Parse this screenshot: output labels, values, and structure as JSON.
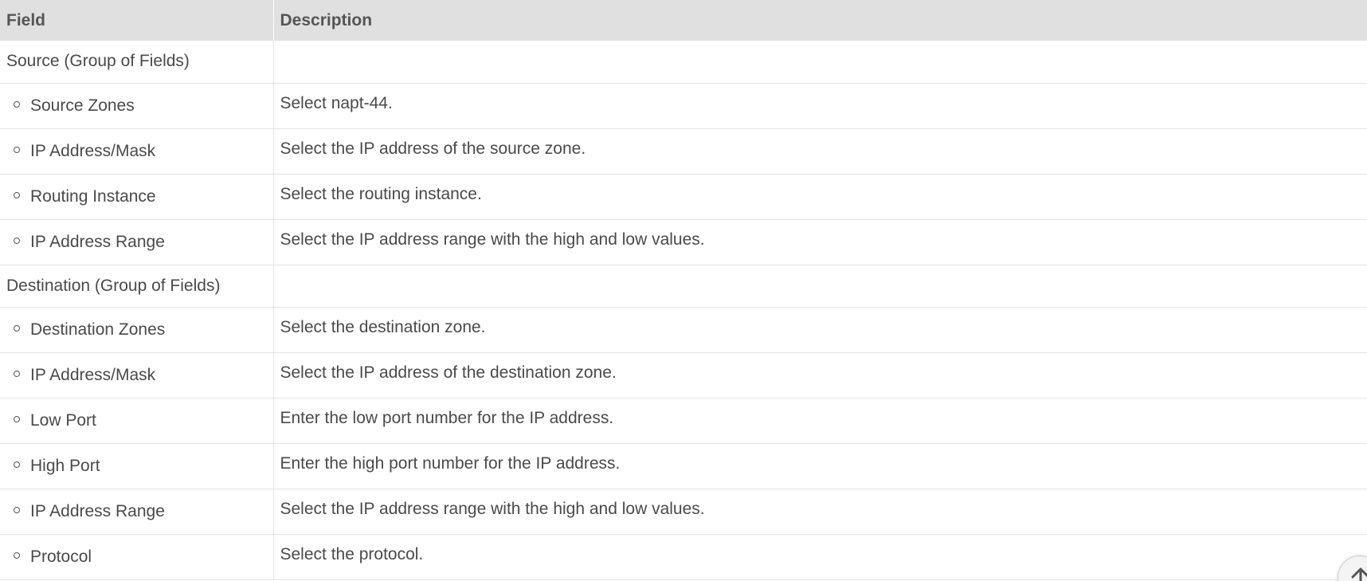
{
  "table": {
    "headers": {
      "field": "Field",
      "description": "Description"
    },
    "rows": [
      {
        "field": "Source (Group of Fields)",
        "description": "",
        "group": true
      },
      {
        "field": "Source Zones",
        "description": "Select napt-44.",
        "group": false
      },
      {
        "field": "IP Address/Mask",
        "description": "Select the IP address of the source zone.",
        "group": false
      },
      {
        "field": "Routing Instance",
        "description": "Select the routing instance.",
        "group": false
      },
      {
        "field": "IP Address Range",
        "description": "Select the IP address range with the high and low values.",
        "group": false
      },
      {
        "field": "Destination (Group of Fields)",
        "description": "",
        "group": true
      },
      {
        "field": "Destination Zones",
        "description": "Select the destination zone.",
        "group": false
      },
      {
        "field": "IP Address/Mask",
        "description": "Select the IP address of the destination zone.",
        "group": false
      },
      {
        "field": "Low Port",
        "description": "Enter the low port number for the IP address.",
        "group": false
      },
      {
        "field": "High Port",
        "description": "Enter the high port number for the IP address.",
        "group": false
      },
      {
        "field": "IP Address Range",
        "description": "Select the IP address range with the high and low values.",
        "group": false
      },
      {
        "field": "Protocol",
        "description": "Select the protocol.",
        "group": false
      }
    ]
  },
  "scroll_top": {
    "icon": "arrow-up-icon"
  },
  "colors": {
    "header_bg": "#e0e0e0",
    "header_text": "#555555",
    "body_text": "#4a4a4a",
    "border": "#e4e4e4"
  }
}
